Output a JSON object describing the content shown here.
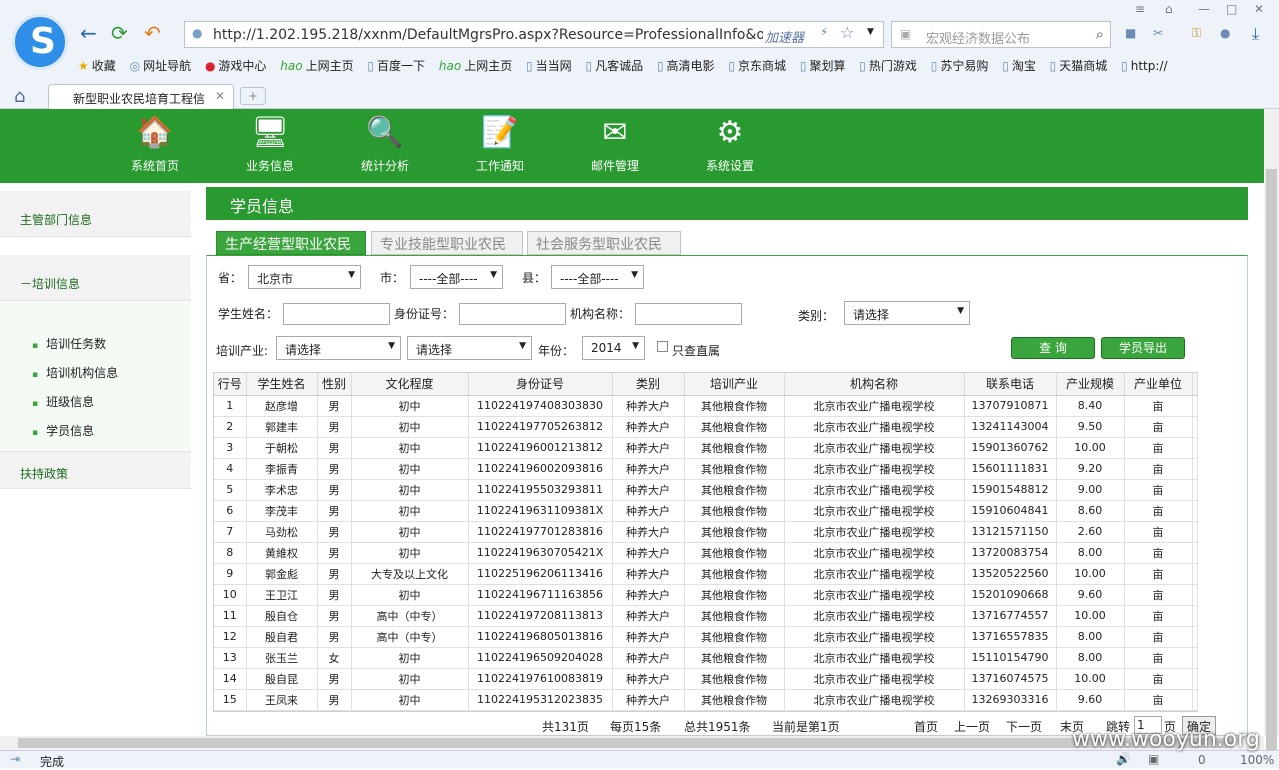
{
  "browser": {
    "address": "http://1.202.195.218/xxnm/DefaultMgrsPro.aspx?Resource=ProfessionalInfo&o=/WebSi",
    "accelerator": "加速器",
    "search_placeholder": "宏观经济数据公布",
    "bookmarks": [
      "收藏",
      "网址导航",
      "游戏中心",
      "上网主页",
      "百度一下",
      "上网主页",
      "当当网",
      "凡客诚品",
      "高清电影",
      "京东商城",
      "聚划算",
      "热门游戏",
      "苏宁易购",
      "淘宝",
      "天猫商城",
      "http://"
    ],
    "tab_title": "新型职业农民培育工程信"
  },
  "nav": [
    "系统首页",
    "业务信息",
    "统计分析",
    "工作通知",
    "邮件管理",
    "系统设置"
  ],
  "sidebar": {
    "sec1": "主管部门信息",
    "sec2": "－培训信息",
    "subs": [
      "培训任务数",
      "培训机构信息",
      "班级信息",
      "学员信息"
    ],
    "sec3": "扶持政策"
  },
  "page_title": "学员信息",
  "tabs": [
    "生产经营型职业农民",
    "专业技能型职业农民",
    "社会服务型职业农民"
  ],
  "form": {
    "prov_label": "省：",
    "prov_val": "北京市",
    "city_label": "市：",
    "city_val": "----全部----",
    "county_label": "县：",
    "county_val": "----全部----",
    "name_label": "学生姓名：",
    "id_label": "身份证号：",
    "org_label": "机构名称：",
    "cat_label": "类别：",
    "cat_val": "请选择",
    "ind_label": "培训产业:",
    "ind_val1": "请选择",
    "ind_val2": "请选择",
    "year_label": "年份：",
    "year_val": "2014",
    "direct_label": "只查直属",
    "query_btn": "查  询",
    "export_btn": "学员导出"
  },
  "table": {
    "headers": [
      "行号",
      "学生姓名",
      "性别",
      "文化程度",
      "身份证号",
      "类别",
      "培训产业",
      "机构名称",
      "联系电话",
      "产业规模",
      "产业单位"
    ],
    "rows": [
      [
        "1",
        "赵彦增",
        "男",
        "初中",
        "110224197408303830",
        "种养大户",
        "其他粮食作物",
        "北京市农业广播电视学校",
        "13707910871",
        "8.40",
        "亩"
      ],
      [
        "2",
        "郭建丰",
        "男",
        "初中",
        "110224197705263812",
        "种养大户",
        "其他粮食作物",
        "北京市农业广播电视学校",
        "13241143004",
        "9.50",
        "亩"
      ],
      [
        "3",
        "于朝松",
        "男",
        "初中",
        "110224196001213812",
        "种养大户",
        "其他粮食作物",
        "北京市农业广播电视学校",
        "15901360762",
        "10.00",
        "亩"
      ],
      [
        "4",
        "李振青",
        "男",
        "初中",
        "110224196002093816",
        "种养大户",
        "其他粮食作物",
        "北京市农业广播电视学校",
        "15601111831",
        "9.20",
        "亩"
      ],
      [
        "5",
        "李术忠",
        "男",
        "初中",
        "110224195503293811",
        "种养大户",
        "其他粮食作物",
        "北京市农业广播电视学校",
        "15901548812",
        "9.00",
        "亩"
      ],
      [
        "6",
        "李茂丰",
        "男",
        "初中",
        "11022419631109381X",
        "种养大户",
        "其他粮食作物",
        "北京市农业广播电视学校",
        "15910604841",
        "8.60",
        "亩"
      ],
      [
        "7",
        "马劲松",
        "男",
        "初中",
        "110224197701283816",
        "种养大户",
        "其他粮食作物",
        "北京市农业广播电视学校",
        "13121571150",
        "2.60",
        "亩"
      ],
      [
        "8",
        "黄維权",
        "男",
        "初中",
        "11022419630705421X",
        "种养大户",
        "其他粮食作物",
        "北京市农业广播电视学校",
        "13720083754",
        "8.00",
        "亩"
      ],
      [
        "9",
        "郭金彪",
        "男",
        "大专及以上文化",
        "110225196206113416",
        "种养大户",
        "其他粮食作物",
        "北京市农业广播电视学校",
        "13520522560",
        "10.00",
        "亩"
      ],
      [
        "10",
        "王卫江",
        "男",
        "初中",
        "110224196711163856",
        "种养大户",
        "其他粮食作物",
        "北京市农业广播电视学校",
        "15201090668",
        "9.60",
        "亩"
      ],
      [
        "11",
        "殷自仓",
        "男",
        "高中（中专）",
        "110224197208113813",
        "种养大户",
        "其他粮食作物",
        "北京市农业广播电视学校",
        "13716774557",
        "10.00",
        "亩"
      ],
      [
        "12",
        "殷自君",
        "男",
        "高中（中专）",
        "110224196805013816",
        "种养大户",
        "其他粮食作物",
        "北京市农业广播电视学校",
        "13716557835",
        "8.00",
        "亩"
      ],
      [
        "13",
        "张玉兰",
        "女",
        "初中",
        "110224196509204028",
        "种养大户",
        "其他粮食作物",
        "北京市农业广播电视学校",
        "15110154790",
        "8.00",
        "亩"
      ],
      [
        "14",
        "殷自昆",
        "男",
        "初中",
        "110224197610083819",
        "种养大户",
        "其他粮食作物",
        "北京市农业广播电视学校",
        "13716074575",
        "10.00",
        "亩"
      ],
      [
        "15",
        "王凤来",
        "男",
        "初中",
        "110224195312023835",
        "种养大户",
        "其他粮食作物",
        "北京市农业广播电视学校",
        "13269303316",
        "9.60",
        "亩"
      ]
    ]
  },
  "pagination": {
    "total_pages": "共131页",
    "per_page": "每页15条",
    "total": "总共1951条",
    "current": "当前是第1页",
    "first": "首页",
    "prev": "上一页",
    "next": "下一页",
    "last": "末页",
    "jump_label": "跳转",
    "jump_val": "1",
    "page_unit": "页",
    "confirm": "确定"
  },
  "status": {
    "text": "完成",
    "zoom": "100%",
    "count": "0"
  },
  "watermark": "www.wooyun.org"
}
